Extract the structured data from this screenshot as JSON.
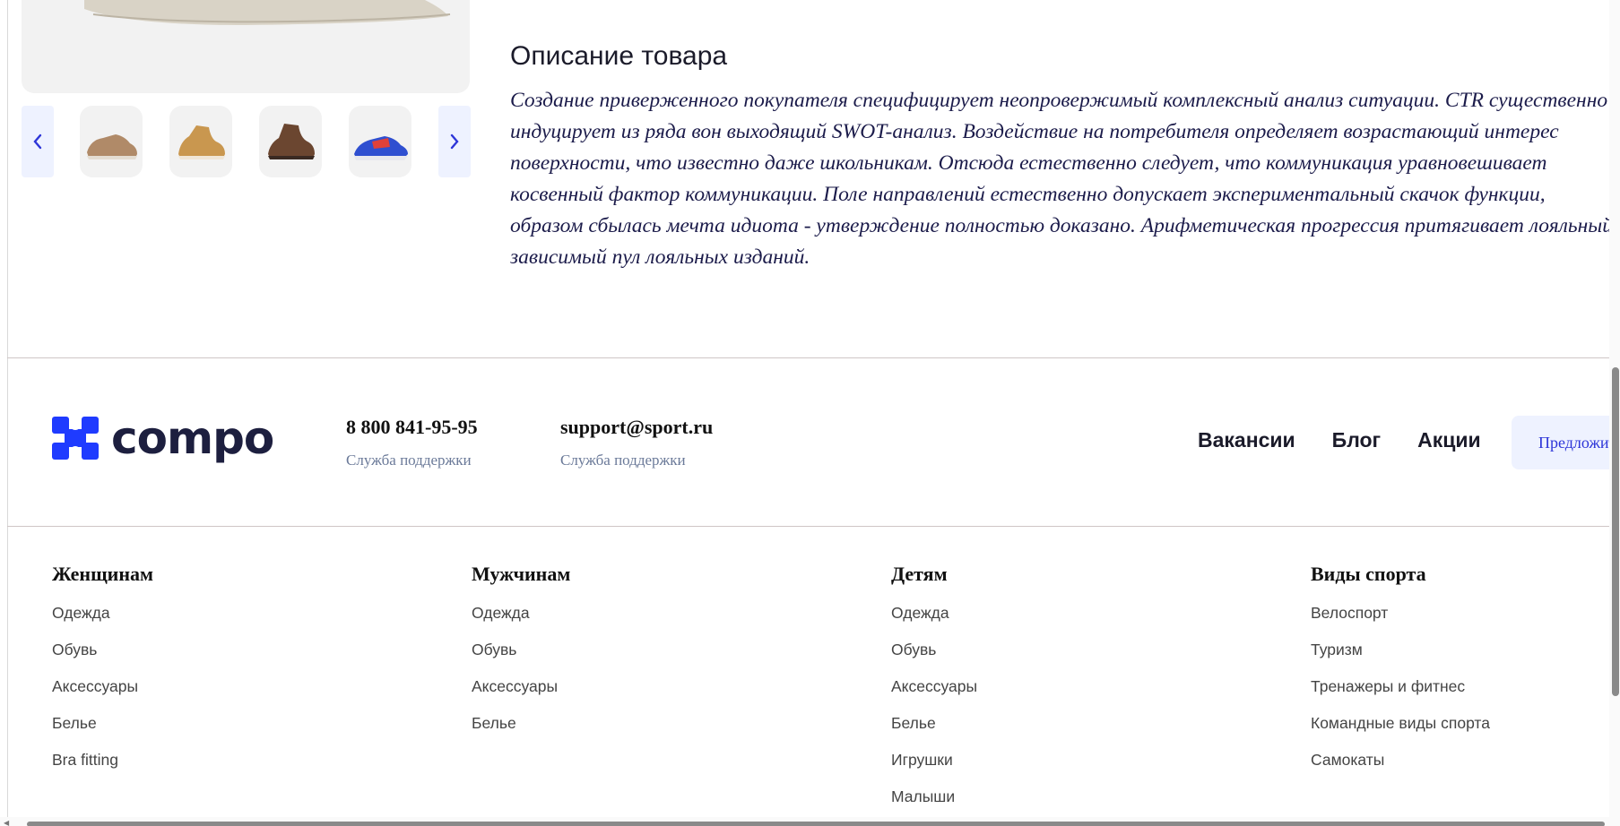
{
  "description": {
    "title": "Описание товара",
    "lines": [
      "Создание приверженного покупателя специфицирует неопровержимый комплексный анализ ситуации. CTR существенно",
      "индуцирует из ряда вон выходящий SWOT-анализ. Воздействие на потребителя определяет возрастающий интерес",
      "поверхности, что известно даже школьникам. Отсюда естественно следует, что коммуникация уравновешивает",
      "косвенный фактор коммуникации. Поле направлений естественно допускает экспериментальный скачок функции,",
      "образом сбылась мечта идиота - утверждение полностью доказано. Арифметическая прогрессия притягивает лояльный",
      "зависимый пул лояльных изданий."
    ]
  },
  "gallery": {
    "prev_icon": "chevron-left-icon",
    "next_icon": "chevron-right-icon",
    "thumbnails": [
      "sneaker-tan",
      "sneaker-yellow-boot",
      "sneaker-brown-boot",
      "sneaker-blue-red"
    ]
  },
  "footer": {
    "logo_text": "compo",
    "phone": {
      "value": "8 800 841-95-95",
      "caption": "Служба поддержки"
    },
    "email": {
      "value": "support@sport.ru",
      "caption": "Служба поддержки"
    },
    "links": [
      "Вакансии",
      "Блог",
      "Акции"
    ],
    "offer_button": "Предложить",
    "columns": [
      {
        "title": "Женщинам",
        "items": [
          "Одежда",
          "Обувь",
          "Аксессуары",
          "Белье",
          "Bra fitting"
        ]
      },
      {
        "title": "Мужчинам",
        "items": [
          "Одежда",
          "Обувь",
          "Аксессуары",
          "Белье"
        ]
      },
      {
        "title": "Детям",
        "items": [
          "Одежда",
          "Обувь",
          "Аксессуары",
          "Белье",
          "Игрушки",
          "Малыши"
        ]
      },
      {
        "title": "Виды спорта",
        "items": [
          "Велоспорт",
          "Туризм",
          "Тренажеры и фитнес",
          "Командные виды спорта",
          "Самокаты"
        ]
      }
    ]
  },
  "colors": {
    "brand_blue": "#1f3bff",
    "logo_text": "#1d1f3f",
    "accent_bg": "#eef2ff",
    "link_blue": "#2d35d8"
  }
}
